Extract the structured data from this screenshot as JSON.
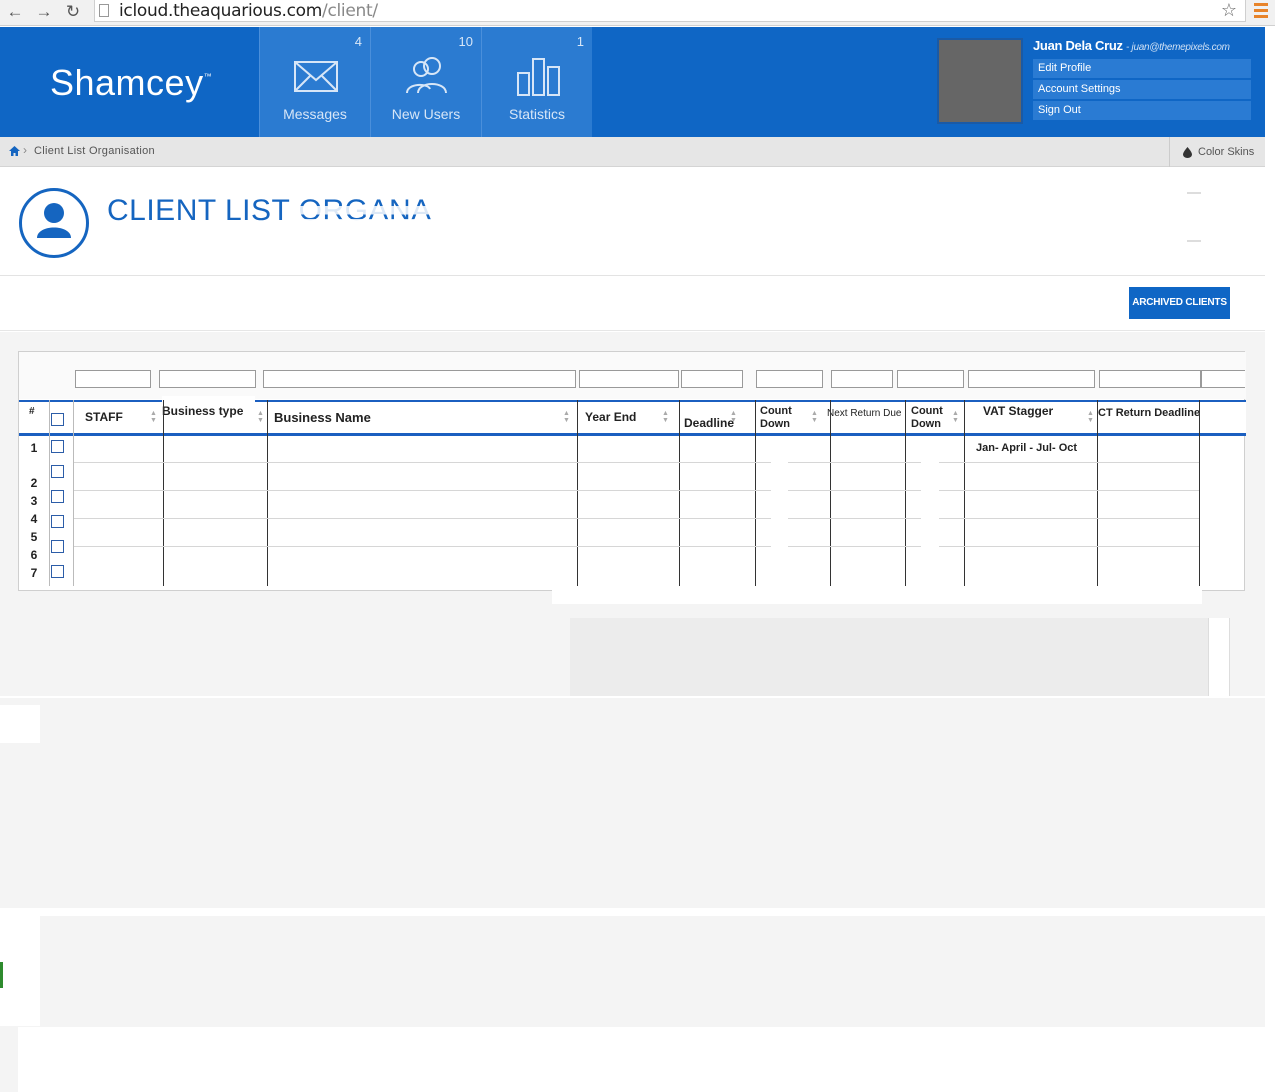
{
  "browser": {
    "url_host": "icloud.theaquarious.com",
    "url_path": "/client/"
  },
  "app": {
    "brand": "Shamcey",
    "brand_tm": "™"
  },
  "header_nav": [
    {
      "label": "Messages",
      "count": "4",
      "icon": "envelope-icon"
    },
    {
      "label": "New Users",
      "count": "10",
      "icon": "users-icon"
    },
    {
      "label": "Statistics",
      "count": "1",
      "icon": "bar-chart-icon"
    }
  ],
  "user": {
    "name": "Juan Dela Cruz",
    "email": "- juan@themepixels.com",
    "menu": [
      "Edit Profile",
      "Account Settings",
      "Sign Out"
    ]
  },
  "breadcrumb": {
    "current": "Client List Organisation"
  },
  "color_skins": "Color Skins",
  "page": {
    "title": "CLIENT LIST ORGANA"
  },
  "actions": {
    "archived_clients": "ARCHIVED CLIENTS"
  },
  "table": {
    "columns": {
      "num": "#",
      "staff": "STAFF",
      "business_type": "Business type",
      "business_name": "Business Name",
      "year_end": "Year End",
      "deadline": "Deadline",
      "count_down_1": "Count Down",
      "next_return_due": "Next Return Due",
      "count_down_2": "Count Down",
      "vat_stagger": "VAT Stagger",
      "ct_return_deadline": "CT Return Deadline"
    },
    "rows": [
      "1",
      "2",
      "3",
      "4",
      "5",
      "6",
      "7"
    ],
    "vat_value": "Jan- April - Jul- Oct"
  },
  "colors": {
    "header_blue": "#0f66c5",
    "nav_tile": "#2b7bd1",
    "title_blue": "#1565c0"
  }
}
